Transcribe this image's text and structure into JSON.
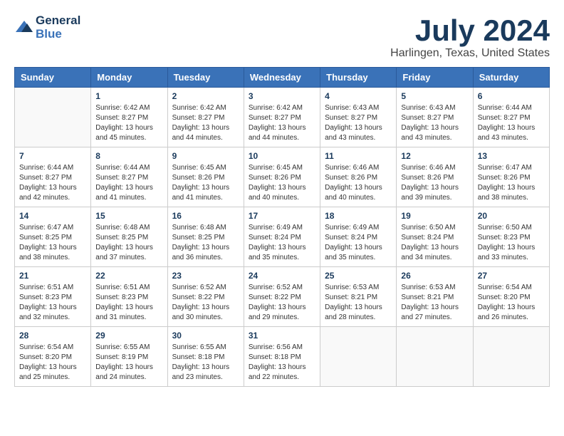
{
  "header": {
    "logo_line1": "General",
    "logo_line2": "Blue",
    "month_year": "July 2024",
    "location": "Harlingen, Texas, United States"
  },
  "weekdays": [
    "Sunday",
    "Monday",
    "Tuesday",
    "Wednesday",
    "Thursday",
    "Friday",
    "Saturday"
  ],
  "weeks": [
    [
      {
        "day": "",
        "sunrise": "",
        "sunset": "",
        "daylight": ""
      },
      {
        "day": "1",
        "sunrise": "6:42 AM",
        "sunset": "8:27 PM",
        "daylight": "13 hours and 45 minutes."
      },
      {
        "day": "2",
        "sunrise": "6:42 AM",
        "sunset": "8:27 PM",
        "daylight": "13 hours and 44 minutes."
      },
      {
        "day": "3",
        "sunrise": "6:42 AM",
        "sunset": "8:27 PM",
        "daylight": "13 hours and 44 minutes."
      },
      {
        "day": "4",
        "sunrise": "6:43 AM",
        "sunset": "8:27 PM",
        "daylight": "13 hours and 43 minutes."
      },
      {
        "day": "5",
        "sunrise": "6:43 AM",
        "sunset": "8:27 PM",
        "daylight": "13 hours and 43 minutes."
      },
      {
        "day": "6",
        "sunrise": "6:44 AM",
        "sunset": "8:27 PM",
        "daylight": "13 hours and 43 minutes."
      }
    ],
    [
      {
        "day": "7",
        "sunrise": "6:44 AM",
        "sunset": "8:27 PM",
        "daylight": "13 hours and 42 minutes."
      },
      {
        "day": "8",
        "sunrise": "6:44 AM",
        "sunset": "8:27 PM",
        "daylight": "13 hours and 41 minutes."
      },
      {
        "day": "9",
        "sunrise": "6:45 AM",
        "sunset": "8:26 PM",
        "daylight": "13 hours and 41 minutes."
      },
      {
        "day": "10",
        "sunrise": "6:45 AM",
        "sunset": "8:26 PM",
        "daylight": "13 hours and 40 minutes."
      },
      {
        "day": "11",
        "sunrise": "6:46 AM",
        "sunset": "8:26 PM",
        "daylight": "13 hours and 40 minutes."
      },
      {
        "day": "12",
        "sunrise": "6:46 AM",
        "sunset": "8:26 PM",
        "daylight": "13 hours and 39 minutes."
      },
      {
        "day": "13",
        "sunrise": "6:47 AM",
        "sunset": "8:26 PM",
        "daylight": "13 hours and 38 minutes."
      }
    ],
    [
      {
        "day": "14",
        "sunrise": "6:47 AM",
        "sunset": "8:25 PM",
        "daylight": "13 hours and 38 minutes."
      },
      {
        "day": "15",
        "sunrise": "6:48 AM",
        "sunset": "8:25 PM",
        "daylight": "13 hours and 37 minutes."
      },
      {
        "day": "16",
        "sunrise": "6:48 AM",
        "sunset": "8:25 PM",
        "daylight": "13 hours and 36 minutes."
      },
      {
        "day": "17",
        "sunrise": "6:49 AM",
        "sunset": "8:24 PM",
        "daylight": "13 hours and 35 minutes."
      },
      {
        "day": "18",
        "sunrise": "6:49 AM",
        "sunset": "8:24 PM",
        "daylight": "13 hours and 35 minutes."
      },
      {
        "day": "19",
        "sunrise": "6:50 AM",
        "sunset": "8:24 PM",
        "daylight": "13 hours and 34 minutes."
      },
      {
        "day": "20",
        "sunrise": "6:50 AM",
        "sunset": "8:23 PM",
        "daylight": "13 hours and 33 minutes."
      }
    ],
    [
      {
        "day": "21",
        "sunrise": "6:51 AM",
        "sunset": "8:23 PM",
        "daylight": "13 hours and 32 minutes."
      },
      {
        "day": "22",
        "sunrise": "6:51 AM",
        "sunset": "8:23 PM",
        "daylight": "13 hours and 31 minutes."
      },
      {
        "day": "23",
        "sunrise": "6:52 AM",
        "sunset": "8:22 PM",
        "daylight": "13 hours and 30 minutes."
      },
      {
        "day": "24",
        "sunrise": "6:52 AM",
        "sunset": "8:22 PM",
        "daylight": "13 hours and 29 minutes."
      },
      {
        "day": "25",
        "sunrise": "6:53 AM",
        "sunset": "8:21 PM",
        "daylight": "13 hours and 28 minutes."
      },
      {
        "day": "26",
        "sunrise": "6:53 AM",
        "sunset": "8:21 PM",
        "daylight": "13 hours and 27 minutes."
      },
      {
        "day": "27",
        "sunrise": "6:54 AM",
        "sunset": "8:20 PM",
        "daylight": "13 hours and 26 minutes."
      }
    ],
    [
      {
        "day": "28",
        "sunrise": "6:54 AM",
        "sunset": "8:20 PM",
        "daylight": "13 hours and 25 minutes."
      },
      {
        "day": "29",
        "sunrise": "6:55 AM",
        "sunset": "8:19 PM",
        "daylight": "13 hours and 24 minutes."
      },
      {
        "day": "30",
        "sunrise": "6:55 AM",
        "sunset": "8:18 PM",
        "daylight": "13 hours and 23 minutes."
      },
      {
        "day": "31",
        "sunrise": "6:56 AM",
        "sunset": "8:18 PM",
        "daylight": "13 hours and 22 minutes."
      },
      {
        "day": "",
        "sunrise": "",
        "sunset": "",
        "daylight": ""
      },
      {
        "day": "",
        "sunrise": "",
        "sunset": "",
        "daylight": ""
      },
      {
        "day": "",
        "sunrise": "",
        "sunset": "",
        "daylight": ""
      }
    ]
  ]
}
